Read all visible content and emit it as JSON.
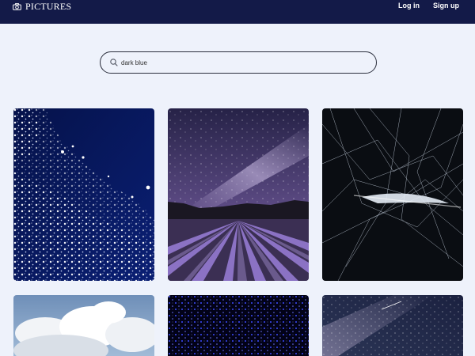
{
  "brand": {
    "label": "PICTURES",
    "icon": "camera-icon"
  },
  "nav": {
    "login": "Log in",
    "signup": "Sign up"
  },
  "search": {
    "value": "dark blue",
    "icon": "search-icon"
  },
  "colors": {
    "topbar": "#131a48",
    "page_background": "#eef2fb"
  },
  "results": [
    {
      "id": "photo-1",
      "subject": "white splashes on dark blue"
    },
    {
      "id": "photo-2",
      "subject": "lavender field under milky way"
    },
    {
      "id": "photo-3",
      "subject": "white web-like lines on black"
    },
    {
      "id": "photo-4",
      "subject": "white clouds on blue sky"
    },
    {
      "id": "photo-5",
      "subject": "blue dots on black"
    },
    {
      "id": "photo-6",
      "subject": "starry night sky"
    }
  ]
}
